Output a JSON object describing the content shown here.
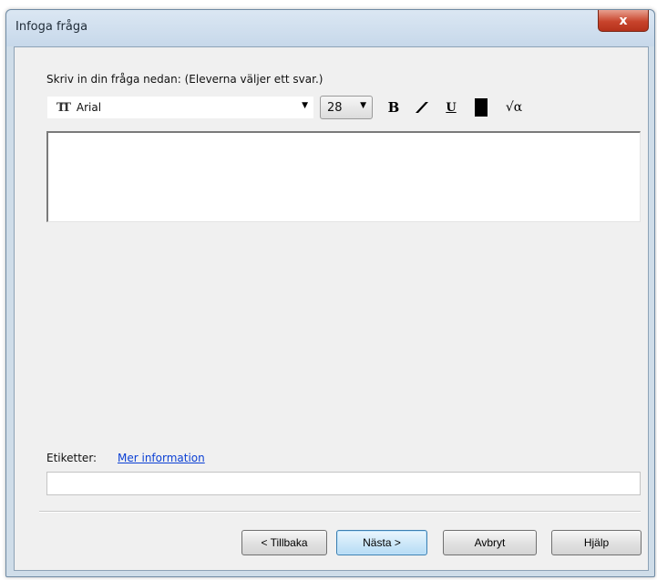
{
  "window": {
    "title": "Infoga fråga",
    "close_glyph": "x"
  },
  "prompt": {
    "label": "Skriv in din fråga nedan: (Eleverna väljer ett svar.)"
  },
  "toolbar": {
    "font_icon": "font-type-icon",
    "font_value": "Arial",
    "size_value": "28",
    "bold_glyph": "B",
    "underline_glyph": "U",
    "math_glyph": "√α",
    "text_color": "#000000"
  },
  "question": {
    "value": ""
  },
  "tags": {
    "label": "Etiketter:",
    "link": "Mer information",
    "value": ""
  },
  "buttons": {
    "back": "< Tillbaka",
    "next": "Nästa >",
    "cancel": "Avbryt",
    "help": "Hjälp"
  },
  "colors": {
    "close_red": "#c8442c",
    "link_blue": "#0a3fd4",
    "next_blue": "#cfe9f9"
  }
}
